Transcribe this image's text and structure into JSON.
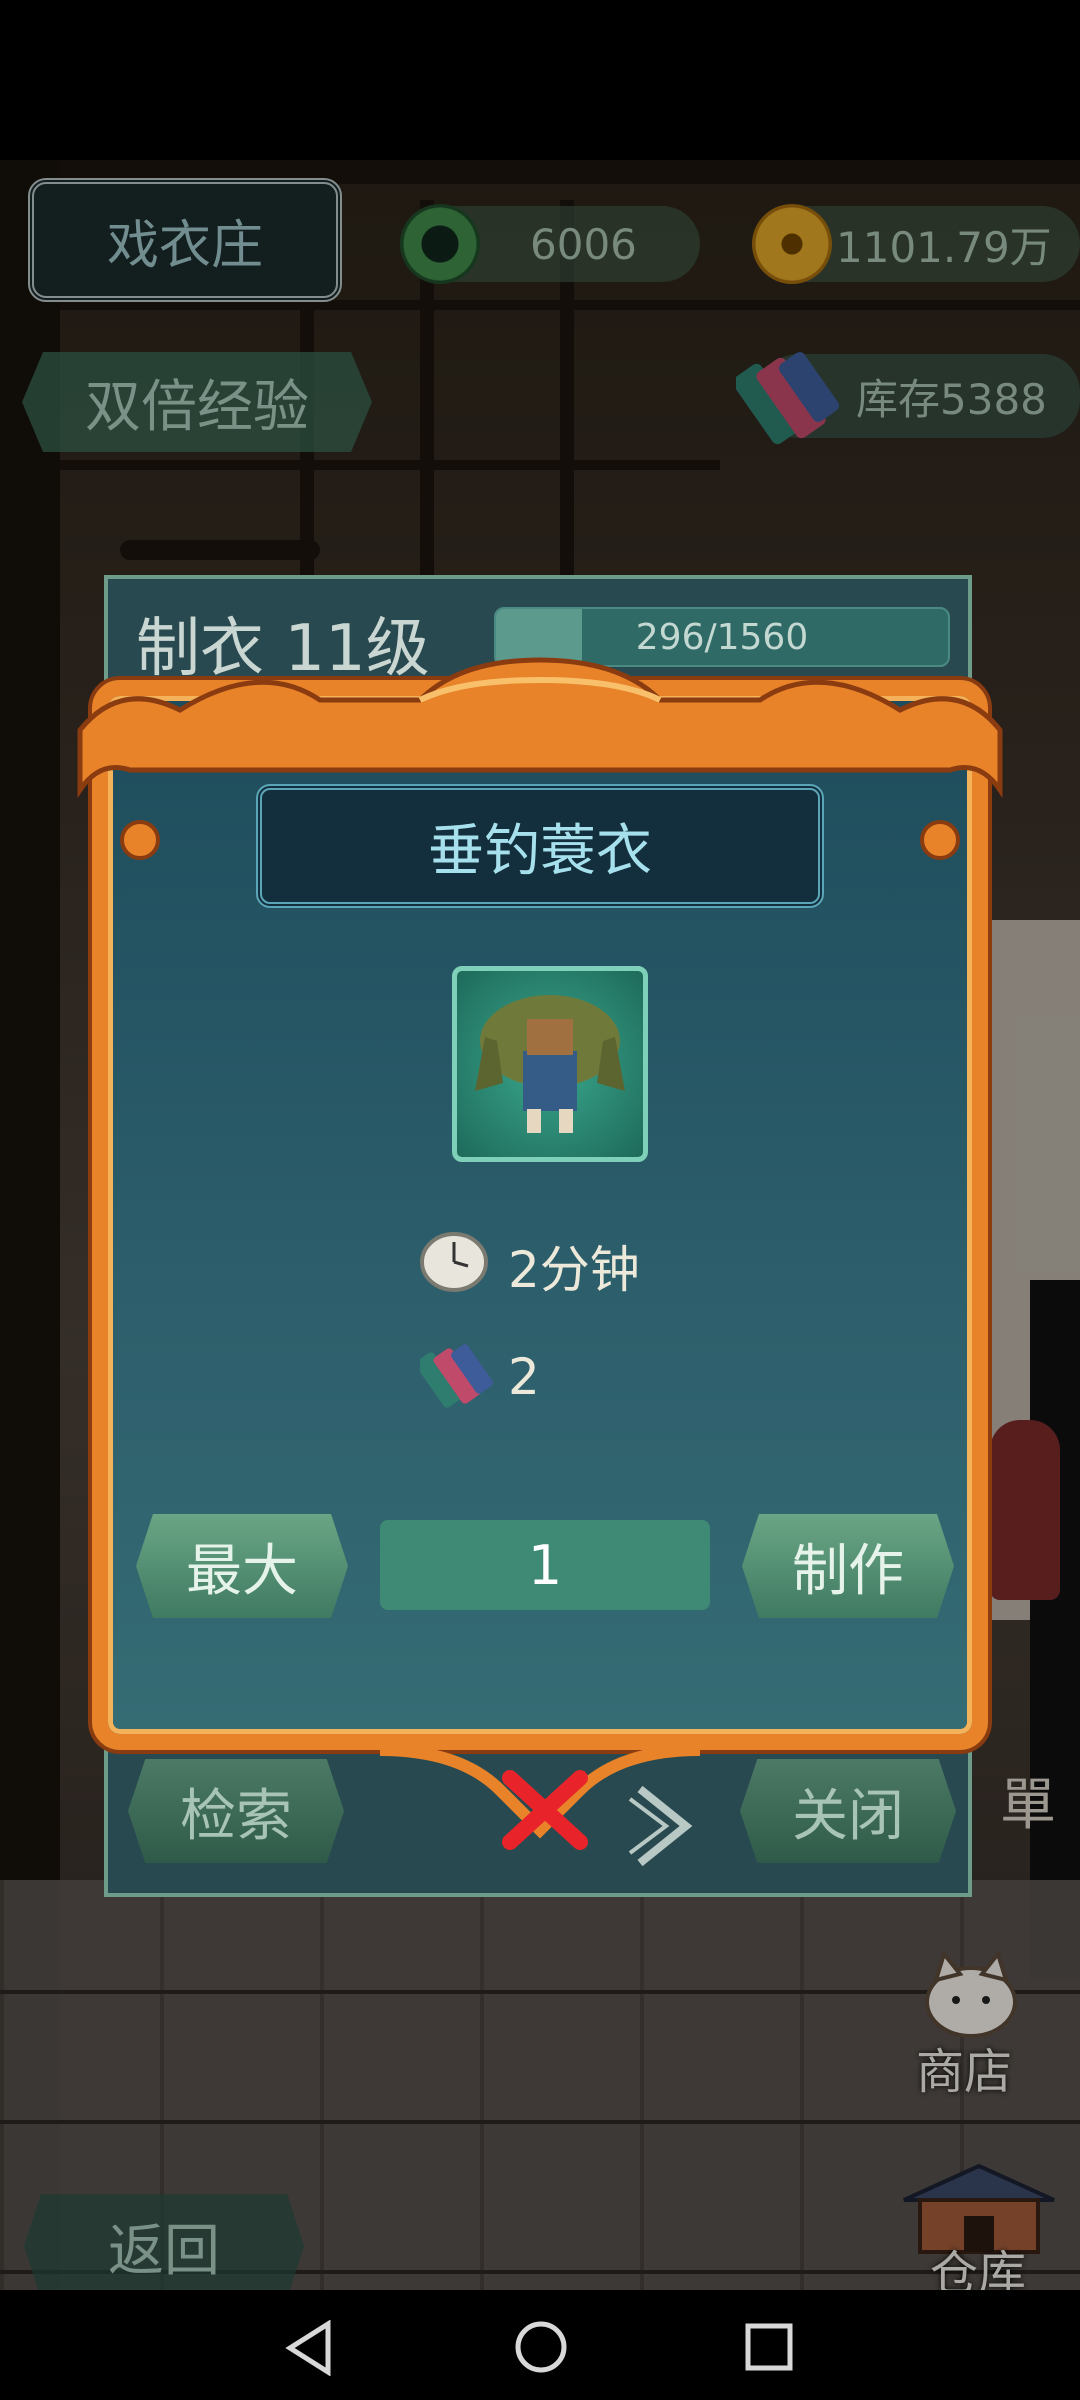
{
  "header": {
    "shop_title": "戏衣庄",
    "jade_currency": "6006",
    "coin_currency": "1101.79万",
    "double_exp": "双倍经验",
    "inventory": "库存5388"
  },
  "tailoring": {
    "level_label": "制衣 11级",
    "exp_text": "296/1560",
    "exp_progress": 0.19
  },
  "dialog": {
    "item_name": "垂钓蓑衣",
    "craft_time": "2分钟",
    "material_cost": "2",
    "max_label": "最大",
    "quantity": "1",
    "craft_label": "制作"
  },
  "panel_bottom": {
    "search_label": "检索",
    "close_label": "关闭"
  },
  "side": {
    "menu_partial": "單",
    "shop_label": "商店",
    "warehouse_label": "仓库"
  },
  "back_label": "返回",
  "colors": {
    "frame_orange": "#e8832a",
    "panel_teal": "#28494f",
    "button_green": "#4f8c70",
    "close_red": "#e8242a"
  },
  "icons": [
    "jade-disc-icon",
    "copper-coin-icon",
    "cloth-bolt-icon",
    "stopwatch-icon",
    "close-x-icon",
    "next-arrow-icon",
    "back-triangle-icon",
    "home-circle-icon",
    "recents-square-icon"
  ]
}
